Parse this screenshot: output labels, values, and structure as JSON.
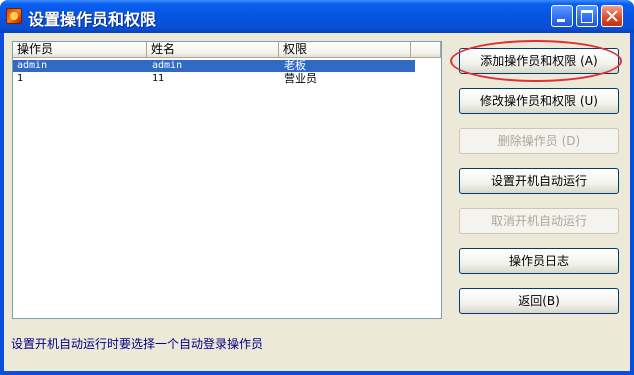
{
  "window": {
    "title": "设置操作员和权限"
  },
  "table": {
    "columns": [
      "操作员",
      "姓名",
      "权限"
    ],
    "rows": [
      {
        "operator": "admin",
        "name": "admin",
        "permission": "老板",
        "selected": true
      },
      {
        "operator": "1",
        "name": "11",
        "permission": "营业员",
        "selected": false
      }
    ]
  },
  "buttons": {
    "add": "添加操作员和权限 (A)",
    "modify": "修改操作员和权限 (U)",
    "delete": "删除操作员 (D)",
    "set_autorun": "设置开机自动运行",
    "cancel_autorun": "取消开机自动运行",
    "log": "操作员日志",
    "back": "返回(B)"
  },
  "hint": "设置开机自动运行时要选择一个自动登录操作员",
  "colors": {
    "selection": "#316ac5",
    "highlight_annotation": "#e0303a",
    "hint_text": "#000080"
  }
}
